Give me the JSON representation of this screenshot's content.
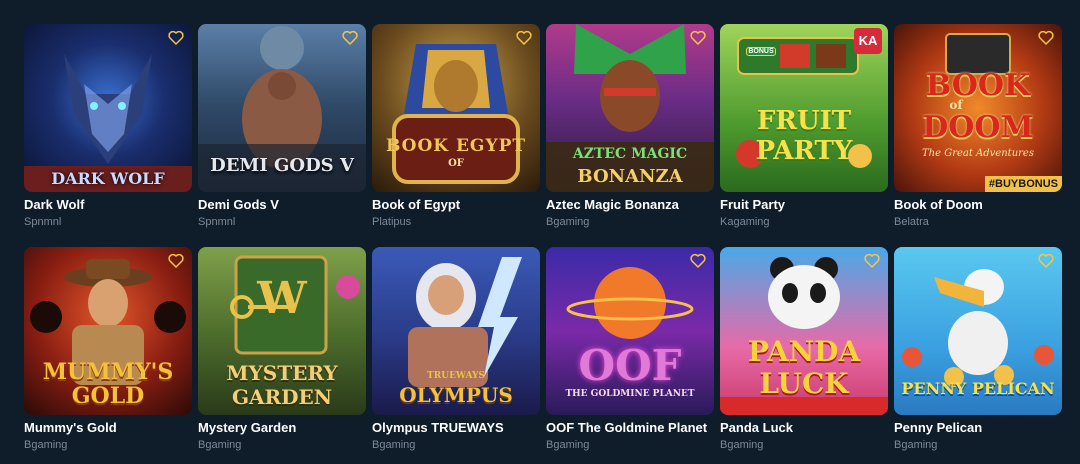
{
  "games": [
    {
      "title": "Dark Wolf",
      "provider": "Spnmnl",
      "logo": "DARK WOLF"
    },
    {
      "title": "Demi Gods V",
      "provider": "Spnmnl",
      "logo": "DEMI GODS V"
    },
    {
      "title": "Book of Egypt",
      "provider": "Platipus",
      "logo": "BOOK EGYPT",
      "logo_small": "OF"
    },
    {
      "title": "Aztec Magic Bonanza",
      "provider": "Bgaming",
      "logo": "AZTEC MAGIC",
      "logo2": "BONANZA"
    },
    {
      "title": "Fruit Party",
      "provider": "Kagaming",
      "logo": "FRUIT",
      "logo2": "PARTY",
      "badge": "KA",
      "chip": "BONUS"
    },
    {
      "title": "Book of Doom",
      "provider": "Belatra",
      "logo": "BOOK",
      "logo_small": "of",
      "logo2": "DOOM",
      "tagline": "The Great Adventures",
      "tag": "#BUYBONUS"
    },
    {
      "title": "Mummy's Gold",
      "provider": "Bgaming",
      "logo": "MUMMY'S",
      "logo2": "GOLD"
    },
    {
      "title": "Mystery Garden",
      "provider": "Bgaming",
      "logo": "MYSTERY",
      "logo2": "GARDEN",
      "emblem": "W"
    },
    {
      "title": "Olympus TRUEWAYS",
      "provider": "Bgaming",
      "logo": "OLYMPUS",
      "logo_small": "TRUEWAYS"
    },
    {
      "title": "OOF The Goldmine Planet",
      "provider": "Bgaming",
      "logo": "OOF",
      "logo2": "THE GOLDMINE PLANET"
    },
    {
      "title": "Panda Luck",
      "provider": "Bgaming",
      "logo": "PANDA",
      "logo2": "LUCK"
    },
    {
      "title": "Penny Pelican",
      "provider": "Bgaming",
      "logo": "PENNY PELICAN"
    }
  ],
  "colors": {
    "background": "#0f1c2a",
    "title": "#ffffff",
    "provider": "#7d8a99",
    "heart": "#f4c542"
  },
  "icons": {
    "favorite": "heart-icon"
  }
}
